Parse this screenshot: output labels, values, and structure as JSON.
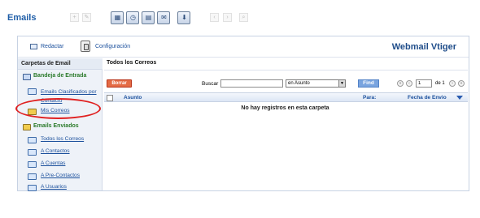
{
  "app": {
    "title": "Emails"
  },
  "toolbar": {
    "icons": [
      "add-icon",
      "edit-icon",
      "calendar-icon",
      "clock-icon",
      "calculator-icon",
      "chat-icon",
      "import-icon",
      "prev-icon",
      "next-icon",
      "find-icon"
    ]
  },
  "top": {
    "compose_label": "Redactar",
    "config_label": "Configuración",
    "brand": "Webmail Vtiger"
  },
  "sidebar": {
    "header": "Carpetas de Email",
    "inbox_group": "Bandeja de Entrada",
    "inbox_items": [
      "Emails Clasificados por Contacto",
      "Mis Correos"
    ],
    "sent_group": "Emails Enviados",
    "sent_items": [
      "Todos los Correos",
      "A Contactos",
      "A Cuentas",
      "A Pre-Contactos",
      "A Usuarios"
    ]
  },
  "main": {
    "title": "Todos los Correos",
    "delete_button": "Borrar",
    "search_label": "Buscar",
    "search_value": "",
    "search_in": "en Asunto",
    "find_button": "Find",
    "page_value": "1",
    "page_of": "de 1",
    "columns": {
      "subject": "Asunto",
      "to": "Para:",
      "date": "Fecha de Envio"
    },
    "empty_message": "No hay registros en esta carpeta"
  },
  "colors": {
    "link": "#1a4f9c",
    "brand": "#1f4d8a",
    "delete_button": "#e46b45",
    "find_button": "#79a4df",
    "highlight": "#e02020"
  }
}
